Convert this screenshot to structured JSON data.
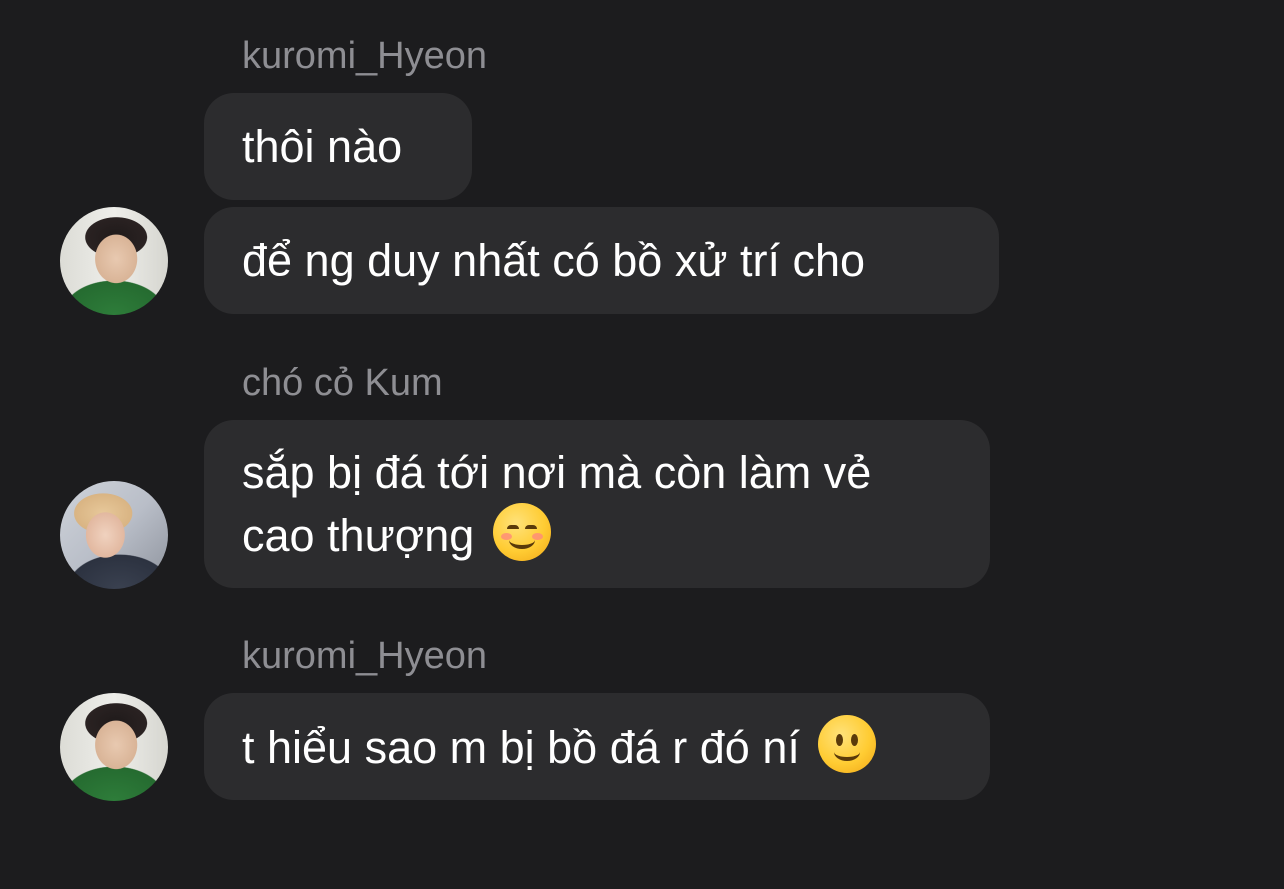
{
  "messages": [
    {
      "sender": "kuromi_Hyeon",
      "bubbles": [
        {
          "lines": [
            "thôi nào"
          ]
        },
        {
          "lines": [
            "để ng duy nhất có bồ xử trí cho"
          ]
        }
      ],
      "avatar": "user-avatar-kuromi"
    },
    {
      "sender": "chó cỏ Kum",
      "bubbles": [
        {
          "lines": [
            "sắp bị đá tới nơi mà còn làm vẻ",
            "cao thượng"
          ],
          "emoji": "smiling-face-with-blush-emoji"
        }
      ],
      "avatar": "user-avatar-chocokum"
    },
    {
      "sender": "kuromi_Hyeon",
      "bubbles": [
        {
          "lines": [
            "t hiểu sao m bị bồ đá r đó ní"
          ],
          "emoji": "slightly-smiling-face-emoji"
        }
      ],
      "avatar": "user-avatar-kuromi"
    }
  ],
  "colors": {
    "background": "#1c1c1e",
    "bubble": "#2c2c2e",
    "sender_name": "#8e8e93",
    "message_text": "#ffffff"
  }
}
